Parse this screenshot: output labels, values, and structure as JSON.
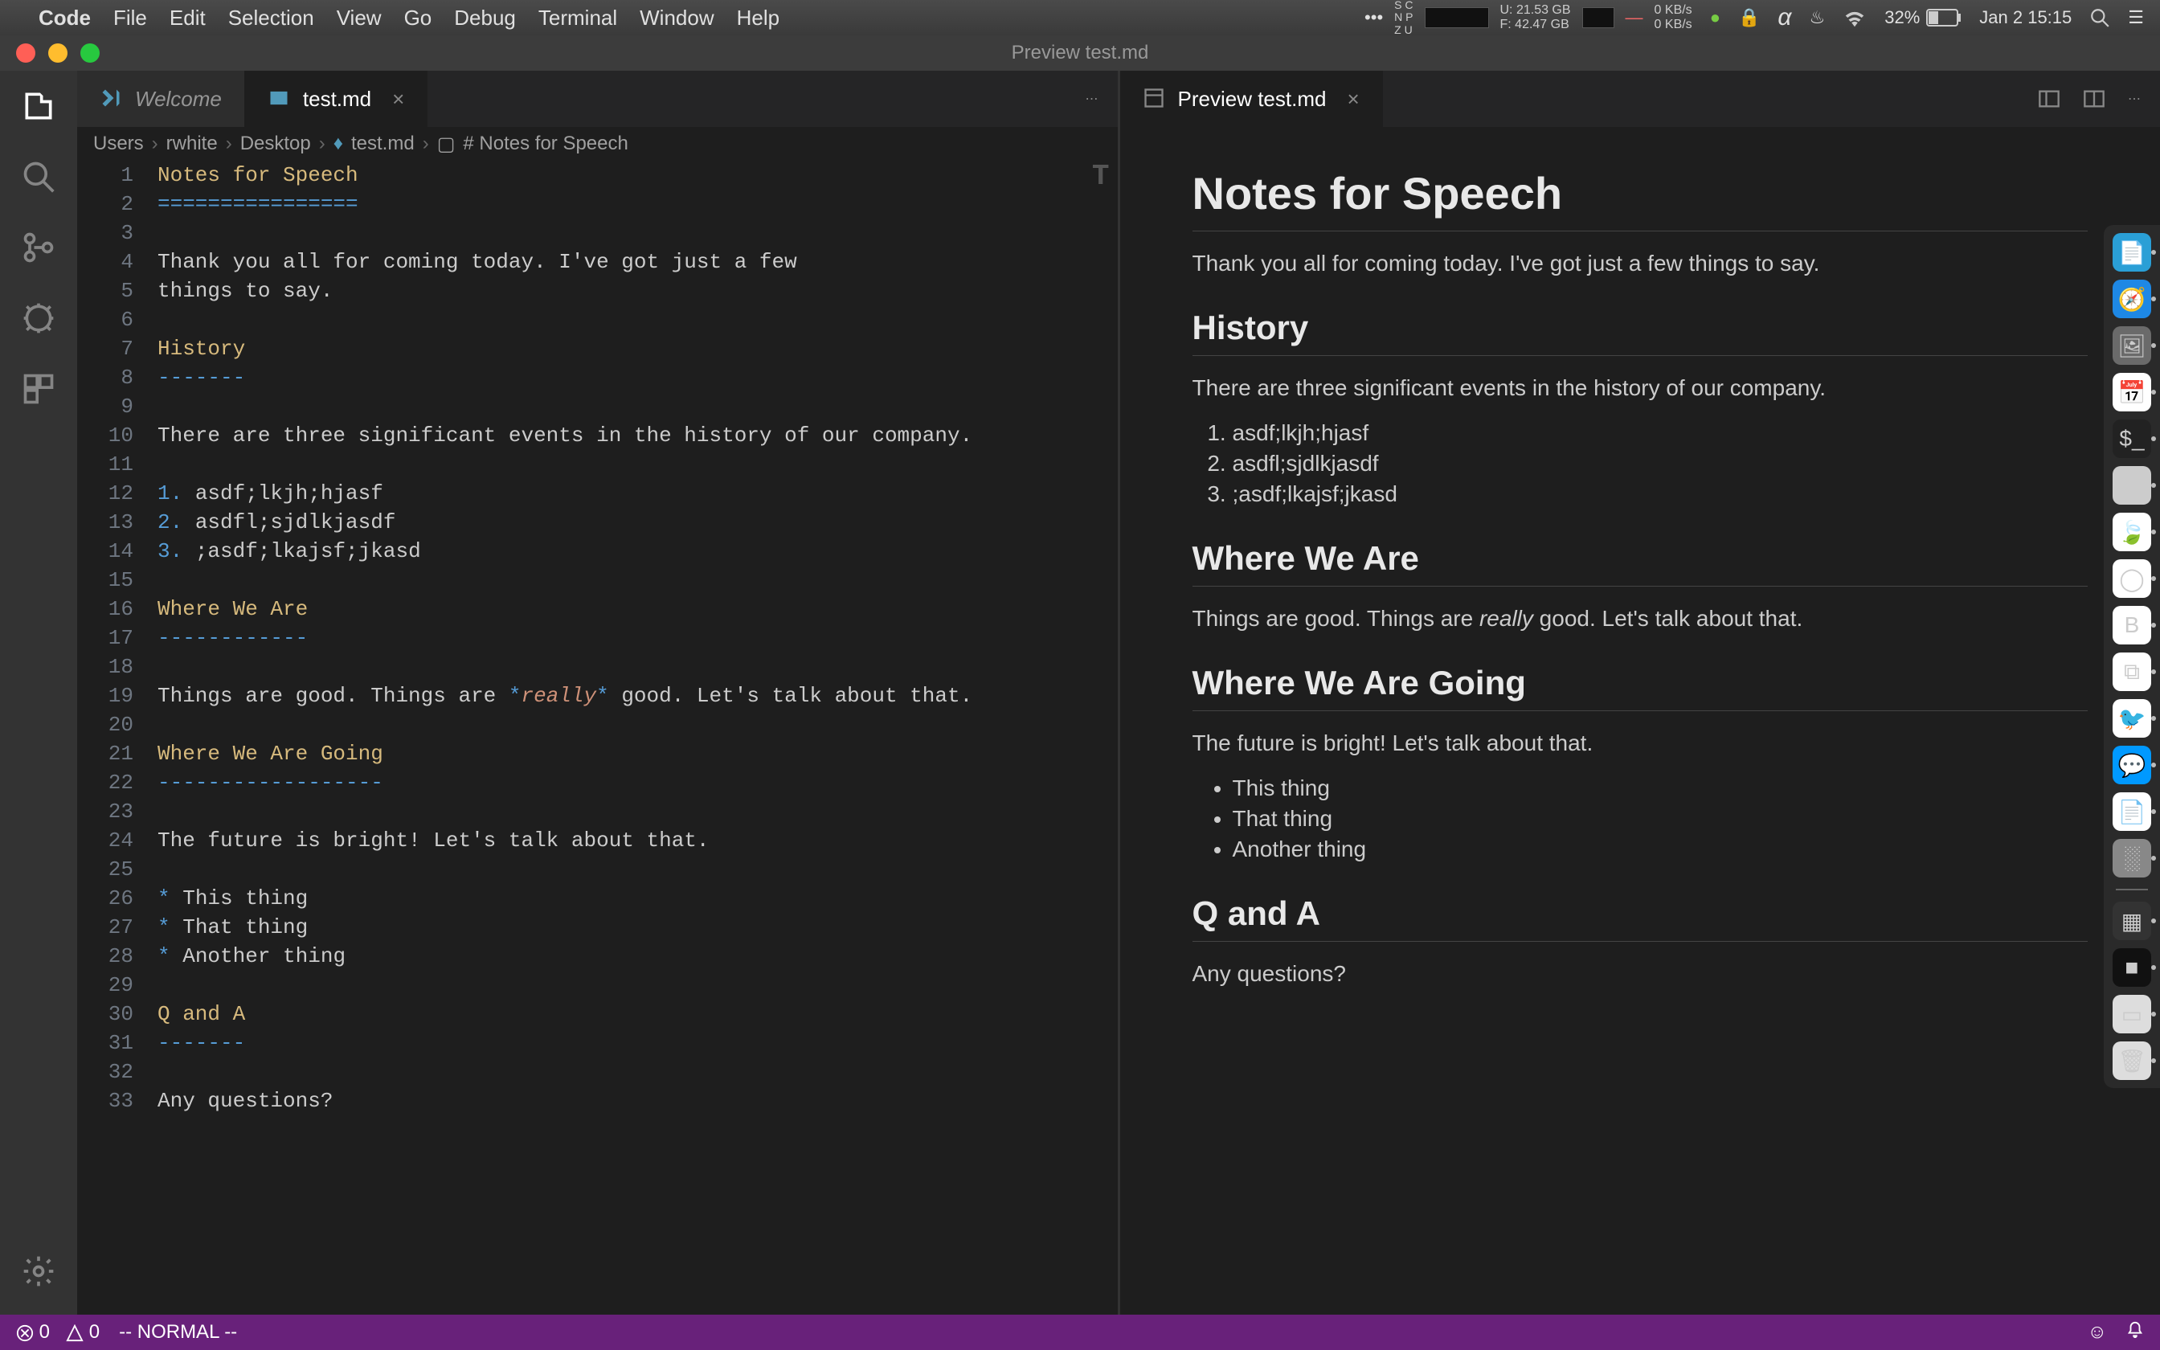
{
  "menubar": {
    "app": "Code",
    "items": [
      "File",
      "Edit",
      "Selection",
      "View",
      "Go",
      "Debug",
      "Terminal",
      "Window",
      "Help"
    ],
    "stats": {
      "mem_u": "U:  21.53 GB",
      "mem_f": "F:  42.47 GB",
      "net_up": "0 KB/s",
      "net_down": "0 KB/s"
    },
    "battery_pct": "32%",
    "datetime": "Jan 2  15:15"
  },
  "window": {
    "title": "Preview test.md"
  },
  "tabs": {
    "left": [
      {
        "label": "Welcome",
        "active": false,
        "icon": "vscode"
      },
      {
        "label": "test.md",
        "active": true,
        "icon": "markdown"
      }
    ],
    "right": [
      {
        "label": "Preview test.md",
        "active": true,
        "icon": "preview"
      }
    ]
  },
  "breadcrumb": [
    "Users",
    "rwhite",
    "Desktop",
    "test.md",
    "# Notes for Speech"
  ],
  "editor_lines": [
    {
      "n": 1,
      "segs": [
        {
          "t": "Notes for Speech",
          "c": "tok-heading"
        }
      ]
    },
    {
      "n": 2,
      "segs": [
        {
          "t": "================",
          "c": "tok-underline"
        }
      ]
    },
    {
      "n": 3,
      "segs": [
        {
          "t": "",
          "c": ""
        }
      ]
    },
    {
      "n": 4,
      "segs": [
        {
          "t": "Thank you all for coming today. I've got just a few",
          "c": ""
        }
      ]
    },
    {
      "n": 5,
      "segs": [
        {
          "t": "things to say.",
          "c": ""
        }
      ]
    },
    {
      "n": 6,
      "segs": [
        {
          "t": "",
          "c": ""
        }
      ]
    },
    {
      "n": 7,
      "segs": [
        {
          "t": "History",
          "c": "tok-heading"
        }
      ]
    },
    {
      "n": 8,
      "segs": [
        {
          "t": "-------",
          "c": "tok-underline"
        }
      ]
    },
    {
      "n": 9,
      "segs": [
        {
          "t": "",
          "c": ""
        }
      ]
    },
    {
      "n": 10,
      "segs": [
        {
          "t": "There are three significant events in the history of our company.",
          "c": ""
        }
      ]
    },
    {
      "n": 11,
      "segs": [
        {
          "t": "",
          "c": ""
        }
      ]
    },
    {
      "n": 12,
      "segs": [
        {
          "t": "1.",
          "c": "tok-num"
        },
        {
          "t": " asdf;lkjh;hjasf",
          "c": ""
        }
      ]
    },
    {
      "n": 13,
      "segs": [
        {
          "t": "2.",
          "c": "tok-num"
        },
        {
          "t": " asdfl;sjdlkjasdf",
          "c": ""
        }
      ]
    },
    {
      "n": 14,
      "segs": [
        {
          "t": "3.",
          "c": "tok-num"
        },
        {
          "t": " ;asdf;lkajsf;jkasd",
          "c": ""
        }
      ]
    },
    {
      "n": 15,
      "segs": [
        {
          "t": "",
          "c": ""
        }
      ]
    },
    {
      "n": 16,
      "segs": [
        {
          "t": "Where We Are",
          "c": "tok-heading"
        }
      ]
    },
    {
      "n": 17,
      "segs": [
        {
          "t": "------------",
          "c": "tok-underline"
        }
      ]
    },
    {
      "n": 18,
      "segs": [
        {
          "t": "",
          "c": ""
        }
      ]
    },
    {
      "n": 19,
      "segs": [
        {
          "t": "Things are good. Things are ",
          "c": ""
        },
        {
          "t": "*",
          "c": "tok-star"
        },
        {
          "t": "really",
          "c": "tok-italic"
        },
        {
          "t": "*",
          "c": "tok-star"
        },
        {
          "t": " good. Let's talk about that.",
          "c": ""
        }
      ]
    },
    {
      "n": 20,
      "segs": [
        {
          "t": "",
          "c": ""
        }
      ]
    },
    {
      "n": 21,
      "segs": [
        {
          "t": "Where We Are Going",
          "c": "tok-heading"
        }
      ]
    },
    {
      "n": 22,
      "segs": [
        {
          "t": "------------------",
          "c": "tok-underline"
        }
      ]
    },
    {
      "n": 23,
      "segs": [
        {
          "t": "",
          "c": ""
        }
      ]
    },
    {
      "n": 24,
      "segs": [
        {
          "t": "The future is bright! Let's talk about that.",
          "c": ""
        }
      ]
    },
    {
      "n": 25,
      "segs": [
        {
          "t": "",
          "c": ""
        }
      ]
    },
    {
      "n": 26,
      "segs": [
        {
          "t": "*",
          "c": "tok-star"
        },
        {
          "t": " This thing",
          "c": ""
        }
      ]
    },
    {
      "n": 27,
      "segs": [
        {
          "t": "*",
          "c": "tok-star"
        },
        {
          "t": " That thing",
          "c": ""
        }
      ]
    },
    {
      "n": 28,
      "segs": [
        {
          "t": "*",
          "c": "tok-star"
        },
        {
          "t": " Another thing",
          "c": ""
        }
      ]
    },
    {
      "n": 29,
      "segs": [
        {
          "t": "",
          "c": ""
        }
      ]
    },
    {
      "n": 30,
      "segs": [
        {
          "t": "Q and A",
          "c": "tok-heading"
        }
      ]
    },
    {
      "n": 31,
      "segs": [
        {
          "t": "-------",
          "c": "tok-underline"
        }
      ]
    },
    {
      "n": 32,
      "segs": [
        {
          "t": "",
          "c": ""
        }
      ]
    },
    {
      "n": 33,
      "segs": [
        {
          "t": "Any questions?",
          "c": ""
        }
      ]
    }
  ],
  "preview": {
    "h1": "Notes for Speech",
    "p1": "Thank you all for coming today. I've got just a few things to say.",
    "h2_history": "History",
    "p2": "There are three significant events in the history of our company.",
    "ol": [
      "asdf;lkjh;hjasf",
      "asdfl;sjdlkjasdf",
      ";asdf;lkajsf;jkasd"
    ],
    "h2_where": "Where We Are",
    "p3_a": "Things are good. Things are ",
    "p3_em": "really",
    "p3_b": " good. Let's talk about that.",
    "h2_going": "Where We Are Going",
    "p4": "The future is bright! Let's talk about that.",
    "ul": [
      "This thing",
      "That thing",
      "Another thing"
    ],
    "h2_qa": "Q and A",
    "p5": "Any questions?"
  },
  "statusbar": {
    "errors": "0",
    "warnings": "0",
    "mode": "-- NORMAL --"
  },
  "dock_items": [
    {
      "name": "finder-icon",
      "bg": "#2a9fd6",
      "emoji": "📄"
    },
    {
      "name": "safari-icon",
      "bg": "#1e88e5",
      "emoji": "🧭"
    },
    {
      "name": "preview-icon",
      "bg": "#6a6a6a",
      "emoji": "🖼"
    },
    {
      "name": "calendar-icon",
      "bg": "#ffffff",
      "emoji": "📅"
    },
    {
      "name": "terminal-icon",
      "bg": "#222",
      "emoji": "$_"
    },
    {
      "name": "maps-icon",
      "bg": "#ccc",
      "emoji": "🗺"
    },
    {
      "name": "leaf-icon",
      "bg": "#fff",
      "emoji": "🍃"
    },
    {
      "name": "circle-icon",
      "bg": "#fff",
      "emoji": "◯"
    },
    {
      "name": "b-icon",
      "bg": "#fff",
      "emoji": "B"
    },
    {
      "name": "vscode-icon",
      "bg": "#fff",
      "emoji": "⧉"
    },
    {
      "name": "bird-icon",
      "bg": "#fff",
      "emoji": "🐦"
    },
    {
      "name": "messages-icon",
      "bg": "#09f",
      "emoji": "💬"
    },
    {
      "name": "page-icon",
      "bg": "#fff",
      "emoji": "📄"
    },
    {
      "name": "pixel-icon",
      "bg": "#888",
      "emoji": "░"
    },
    {
      "name": "mission-icon",
      "bg": "#333",
      "emoji": "▦"
    },
    {
      "name": "dark-icon",
      "bg": "#111",
      "emoji": "■"
    },
    {
      "name": "window-icon",
      "bg": "#ddd",
      "emoji": "▭"
    },
    {
      "name": "trash-icon",
      "bg": "#ddd",
      "emoji": "🗑"
    }
  ]
}
